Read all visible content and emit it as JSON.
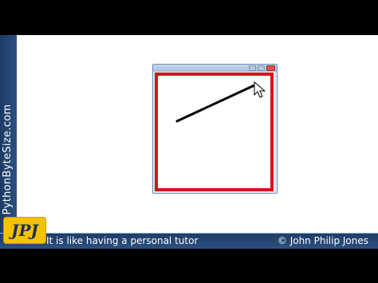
{
  "branding": {
    "site": "PythonByteSize.com",
    "logo_text": "JPJ",
    "tagline": "It is like having a personal tutor",
    "copyright": "© John Philip Jones"
  },
  "window": {
    "controls": [
      "minimize-icon",
      "maximize-icon",
      "close-icon"
    ],
    "canvas_border_color": "#d3151d"
  },
  "drawing": {
    "line_color": "#000000",
    "cursor": "arrow-cursor-icon"
  }
}
